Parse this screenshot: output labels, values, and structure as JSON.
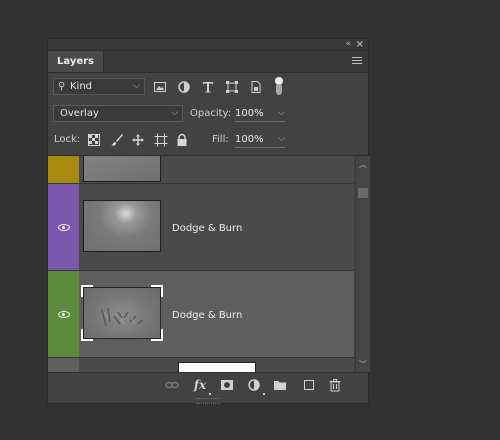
{
  "panel": {
    "tab_label": "Layers",
    "collapse_glyph": "«",
    "close_glyph": "×"
  },
  "filter": {
    "kind_label": "Kind",
    "kind_arrow": "⌵",
    "icons": [
      "image-filter-icon",
      "adjustment-filter-icon",
      "type-filter-icon",
      "shape-filter-icon",
      "smart-object-filter-icon"
    ],
    "filter_toggle": "on"
  },
  "blend": {
    "mode": "Overlay",
    "opacity_label": "Opacity:",
    "opacity_value": "100%"
  },
  "lock": {
    "label": "Lock:",
    "fill_label": "Fill:",
    "fill_value": "100%"
  },
  "layers": [
    {
      "name": "",
      "color": "#a88b0e",
      "visible": false
    },
    {
      "name": "Dodge & Burn",
      "color": "#7a58ad",
      "visible": true
    },
    {
      "name": "Dodge & Burn",
      "color": "#5b8a3c",
      "visible": true,
      "selected": true
    },
    {
      "name": "",
      "color": "#5e5e5e",
      "visible": false
    }
  ],
  "bottom_icons": [
    "link-layers-icon",
    "fx-icon",
    "layer-mask-icon",
    "new-adjustment-icon",
    "new-group-icon",
    "new-layer-icon",
    "delete-layer-icon"
  ],
  "bottom": {
    "fx_label": "fx"
  }
}
